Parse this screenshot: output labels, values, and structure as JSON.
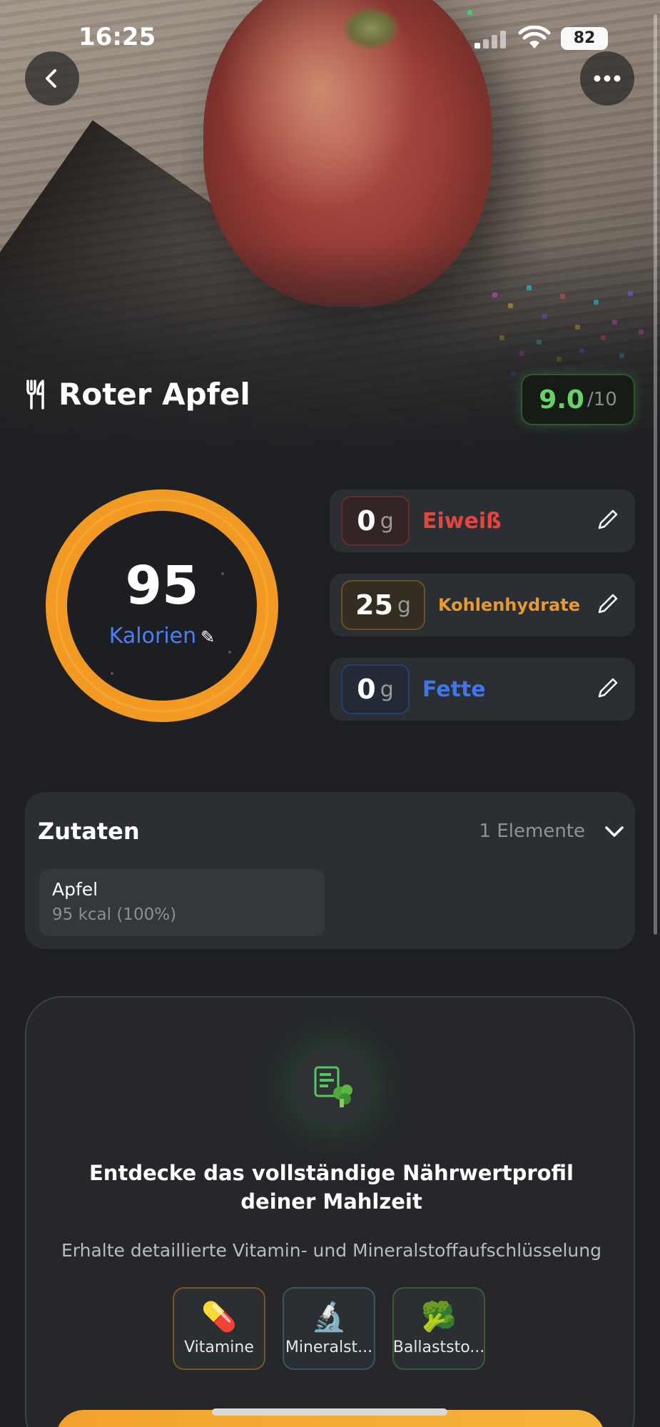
{
  "status_bar": {
    "time": "16:25",
    "battery": "82"
  },
  "meal": {
    "title": "Roter Apfel",
    "score": "9.0",
    "score_max": "/10"
  },
  "calories": {
    "value": "95",
    "label": "Kalorien"
  },
  "macros": [
    {
      "name": "Eiweiß",
      "amount": "0",
      "unit": "g",
      "color": "#e2463f"
    },
    {
      "name": "Kohlenhydrate",
      "amount": "25",
      "unit": "g",
      "color": "#e89a2c"
    },
    {
      "name": "Fette",
      "amount": "0",
      "unit": "g",
      "color": "#3f76e8"
    }
  ],
  "ingredients": {
    "title": "Zutaten",
    "count": "1 Elemente",
    "items": [
      {
        "name": "Apfel",
        "info": "95 kcal (100%)"
      }
    ]
  },
  "promo": {
    "title_line1": "Entdecke das vollständige Nährwertprofil",
    "title_line2": "deiner Mahlzeit",
    "subtitle": "Erhalte detaillierte Vitamin- und Mineralstoffaufschlüsselung",
    "chips": [
      {
        "label": "Vitamine",
        "icon": "pill-icon",
        "glyph": "💊",
        "border": "#7a5524"
      },
      {
        "label": "Mineralst...",
        "icon": "microscope-icon",
        "glyph": "🔬",
        "border": "#3a5560"
      },
      {
        "label": "Ballaststo...",
        "icon": "broccoli-icon",
        "glyph": "🥦",
        "border": "#3a5a38"
      }
    ]
  },
  "colors": {
    "accent_orange": "#f29a23",
    "score_green": "#66d36a",
    "card_bg": "#2b2e32"
  }
}
